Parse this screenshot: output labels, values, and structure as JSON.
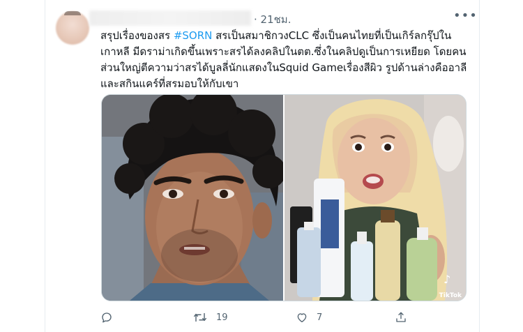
{
  "tweet": {
    "timestamp": "· 21ชม.",
    "more_icon": "more-horizontal-icon",
    "text_lines": [
      {
        "before": "สรุปเรื่องของสร ",
        "hashtag": "#SORN",
        "after": " สรเป็นสมาชิกวงCLC ซึ่งเป็นคนไทยที่เป็นเกิร์ลกรุ๊ปใน"
      },
      {
        "before": "เกาหลี มีดราม่าเกิดขึ้นเพราะสรได้ลงคลิปในตต.ซึ่งในคลิปดูเป็นการเหยียด โดยคน"
      },
      {
        "before": "ส่วนใหญ่ตีความว่าสรได้บูลลี่นักแสดงในSquid Gameเรื่องสีผิว รูปด้านล่างคืออาลี"
      },
      {
        "before": "และสกินแคร์ที่สรมอบให้กับเขา"
      }
    ],
    "media": {
      "left_photo": "portrait of actor with curly dark hair",
      "right_photo": "woman with blonde hair holding skincare products",
      "watermark": "TikTok"
    },
    "actions": {
      "reply": {
        "icon": "reply-icon",
        "count": ""
      },
      "retweet": {
        "icon": "retweet-icon",
        "count": "19"
      },
      "like": {
        "icon": "heart-icon",
        "count": "7"
      },
      "share": {
        "icon": "share-icon",
        "count": ""
      }
    }
  }
}
